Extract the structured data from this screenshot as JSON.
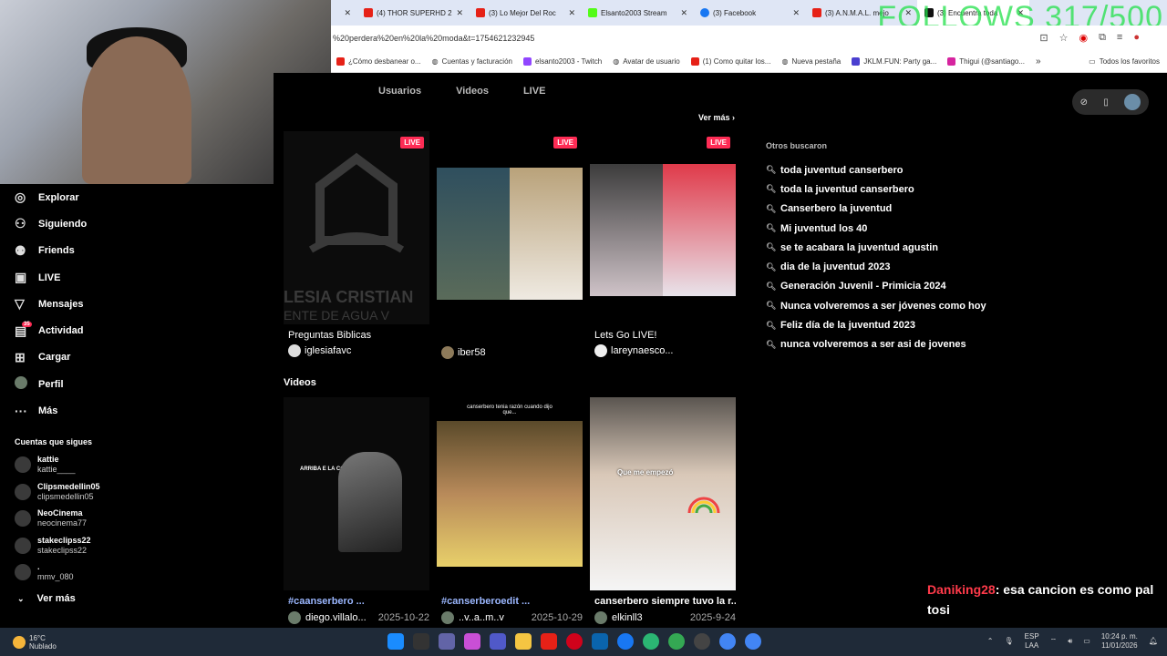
{
  "browser": {
    "overlay": "FOLLOWS 317/500",
    "tabs": [
      {
        "label": "(4) THOR SUPERHD 2",
        "icon": "youtube-icon",
        "active": false
      },
      {
        "label": "(3) Lo Mejor Del Roc",
        "icon": "youtube-icon",
        "active": false
      },
      {
        "label": "Elsanto2003 Stream",
        "icon": "kick-icon",
        "active": false
      },
      {
        "label": "(3) Facebook",
        "icon": "facebook-icon",
        "active": false
      },
      {
        "label": "(3) A.N.M.A.L. mejo",
        "icon": "youtube-icon",
        "active": false
      },
      {
        "label": "(3) Encuentra toda",
        "icon": "tiktok-icon",
        "active": true
      }
    ],
    "url": "%20perdera%20en%20la%20moda&t=1754621232945",
    "bookmarks": [
      "¿Cómo desbanear o...",
      "Cuentas y facturación",
      "elsanto2003 - Twitch",
      "Avatar de usuario",
      "(1) Como quitar los...",
      "Nueva pestaña",
      "JKLM.FUN: Party ga...",
      "Thigui (@santiago..."
    ],
    "bookmarks_all": "Todos los favoritos"
  },
  "sidebar": {
    "nav": [
      {
        "label": "Explorar",
        "icon": "compass-icon"
      },
      {
        "label": "Siguiendo",
        "icon": "person-plus-icon"
      },
      {
        "label": "Friends",
        "icon": "friends-icon"
      },
      {
        "label": "LIVE",
        "icon": "live-tv-icon"
      },
      {
        "label": "Mensajes",
        "icon": "send-icon"
      },
      {
        "label": "Actividad",
        "icon": "activity-icon",
        "badge": "35"
      },
      {
        "label": "Cargar",
        "icon": "upload-icon"
      },
      {
        "label": "Perfil",
        "icon": "profile-icon"
      },
      {
        "label": "Más",
        "icon": "more-dots-icon"
      }
    ],
    "following_title": "Cuentas que sigues",
    "following": [
      {
        "name": "kattie",
        "handle": "kattie____"
      },
      {
        "name": "Clipsmedellin05",
        "handle": "clipsmedellin05"
      },
      {
        "name": "NeoCinema",
        "handle": "neocinema77"
      },
      {
        "name": "stakeclipss22",
        "handle": "stakeclipss22"
      },
      {
        "name": ".",
        "handle": "mmv_080"
      }
    ],
    "see_more": "Ver más"
  },
  "main": {
    "tabs": [
      "Usuarios",
      "Videos",
      "LIVE"
    ],
    "see_more": "Ver más",
    "live_badge": "LIVE",
    "lives": [
      {
        "title": "Preguntas Biblicas",
        "user": "iglesiafavc",
        "thumb_text": "LESIA CRISTIAN",
        "thumb_text2": "ENTE DE AGUA V"
      },
      {
        "title": "",
        "user": "iber58"
      },
      {
        "title": "Lets Go LIVE!",
        "user": "lareynaesco..."
      }
    ],
    "videos_title": "Videos",
    "videos": [
      {
        "title": "#caanserbero ...",
        "user": "diego.villalo...",
        "date": "2025-10-22",
        "tag": true,
        "caption": "ARRIBA E LA COLA"
      },
      {
        "title": "#canserberoedit ...",
        "user": "..v..a..m..v",
        "date": "2025-10-29",
        "tag": true,
        "caption": "canserbero tenia razón cuando dijo que..."
      },
      {
        "title": "canserbero siempre tuvo la r...",
        "user": "elkinll3",
        "date": "2025-9-24",
        "tag": false,
        "caption": "Que me empezó"
      }
    ]
  },
  "right": {
    "others_title": "Otros buscaron",
    "suggestions": [
      "toda juventud canserbero",
      "toda la juventud canserbero",
      "Canserbero la juventud",
      "Mi juventud los 40",
      "se te acabara la juventud agustin",
      "dia de la juventud 2023",
      "Generación Juvenil - Primicia 2024",
      "Nunca volveremos a ser jóvenes como hoy",
      "Feliz día de la juventud 2023",
      "nunca volveremos a ser asi de jovenes"
    ]
  },
  "chat": {
    "user": "Daniking28",
    "message": ": esa cancion es como pal tosi"
  },
  "taskbar": {
    "temp": "16°C",
    "weather": "Nublado",
    "lang1": "ESP",
    "lang2": "LAA",
    "time": "10:24 p. m.",
    "date": "11/01/2026"
  }
}
